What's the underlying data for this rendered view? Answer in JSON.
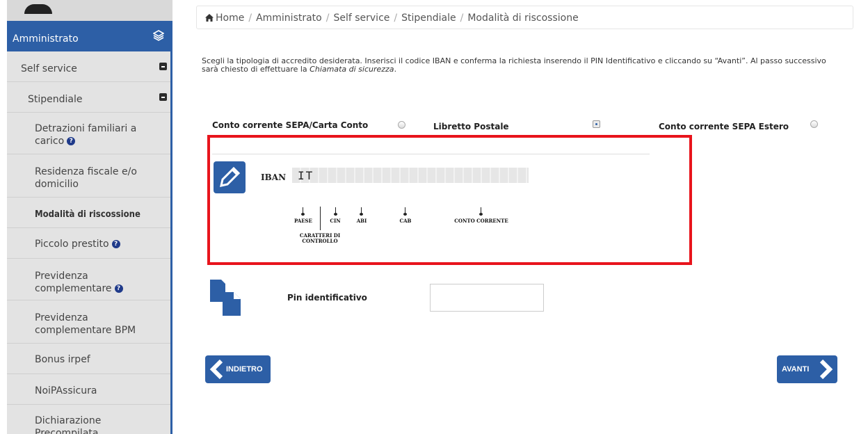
{
  "sidebar": {
    "header": "Amministrato",
    "items": [
      {
        "label": "Self service"
      },
      {
        "label": "Stipendiale"
      },
      {
        "label": "Detrazioni familiari a carico"
      },
      {
        "label": "Residenza fiscale e/o domicilio"
      },
      {
        "label": "Modalità di riscossione"
      },
      {
        "label": "Piccolo prestito"
      },
      {
        "label": "Previdenza complementare"
      },
      {
        "label": "Previdenza complementare BPM"
      },
      {
        "label": "Bonus irpef"
      },
      {
        "label": "NoiPAssicura"
      },
      {
        "label": "Dichiarazione Precompilata"
      }
    ]
  },
  "breadcrumb": [
    "Home",
    "Amministrato",
    "Self service",
    "Stipendiale",
    "Modalità di riscossione"
  ],
  "intro": {
    "text": "Scegli la tipologia di accredito desiderata. Inserisci il codice IBAN e conferma la richiesta inserendo il PIN Identificativo e cliccando su “Avanti”. Al passo successivo sarà chiesto di effettuare la ",
    "emphasis": "Chiamata di sicurezza",
    "end": "."
  },
  "payment_options": [
    {
      "label": "Conto corrente SEPA/Carta Conto",
      "selected": false
    },
    {
      "label": "Libretto Postale",
      "selected": true
    },
    {
      "label": "Conto corrente SEPA Estero",
      "selected": false
    }
  ],
  "iban": {
    "label": "IBAN",
    "prefix": "IT",
    "parts": {
      "paese": "PAESE",
      "cin": "CIN",
      "abi": "ABI",
      "cab": "CAB",
      "conto": "CONTO CORRENTE",
      "check_line1": "CARATTERI DI",
      "check_line2": "CONTROLLO"
    }
  },
  "pin": {
    "label": "Pin identificativo",
    "value": ""
  },
  "buttons": {
    "back": "INDIETRO",
    "next": "AVANTI"
  },
  "colors": {
    "primary": "#2d5fa6",
    "highlight": "#e8141c"
  }
}
